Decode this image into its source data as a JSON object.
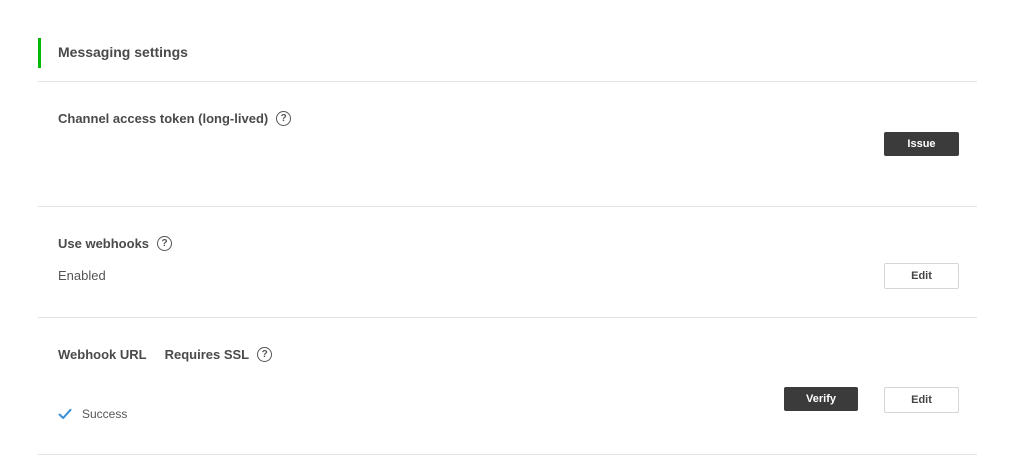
{
  "section": {
    "title": "Messaging settings"
  },
  "token": {
    "label": "Channel access token (long-lived)",
    "help": "?",
    "issue_label": "Issue"
  },
  "webhooks": {
    "label": "Use webhooks",
    "help": "?",
    "status": "Enabled",
    "edit_label": "Edit"
  },
  "webhook_url": {
    "label": "Webhook URL",
    "requirement": "Requires SSL",
    "help": "?",
    "verify_label": "Verify",
    "edit_label": "Edit",
    "result": "Success"
  },
  "colors": {
    "accent": "#00b900",
    "dark_button": "#3b3b3b",
    "check": "#3a8fd6"
  }
}
